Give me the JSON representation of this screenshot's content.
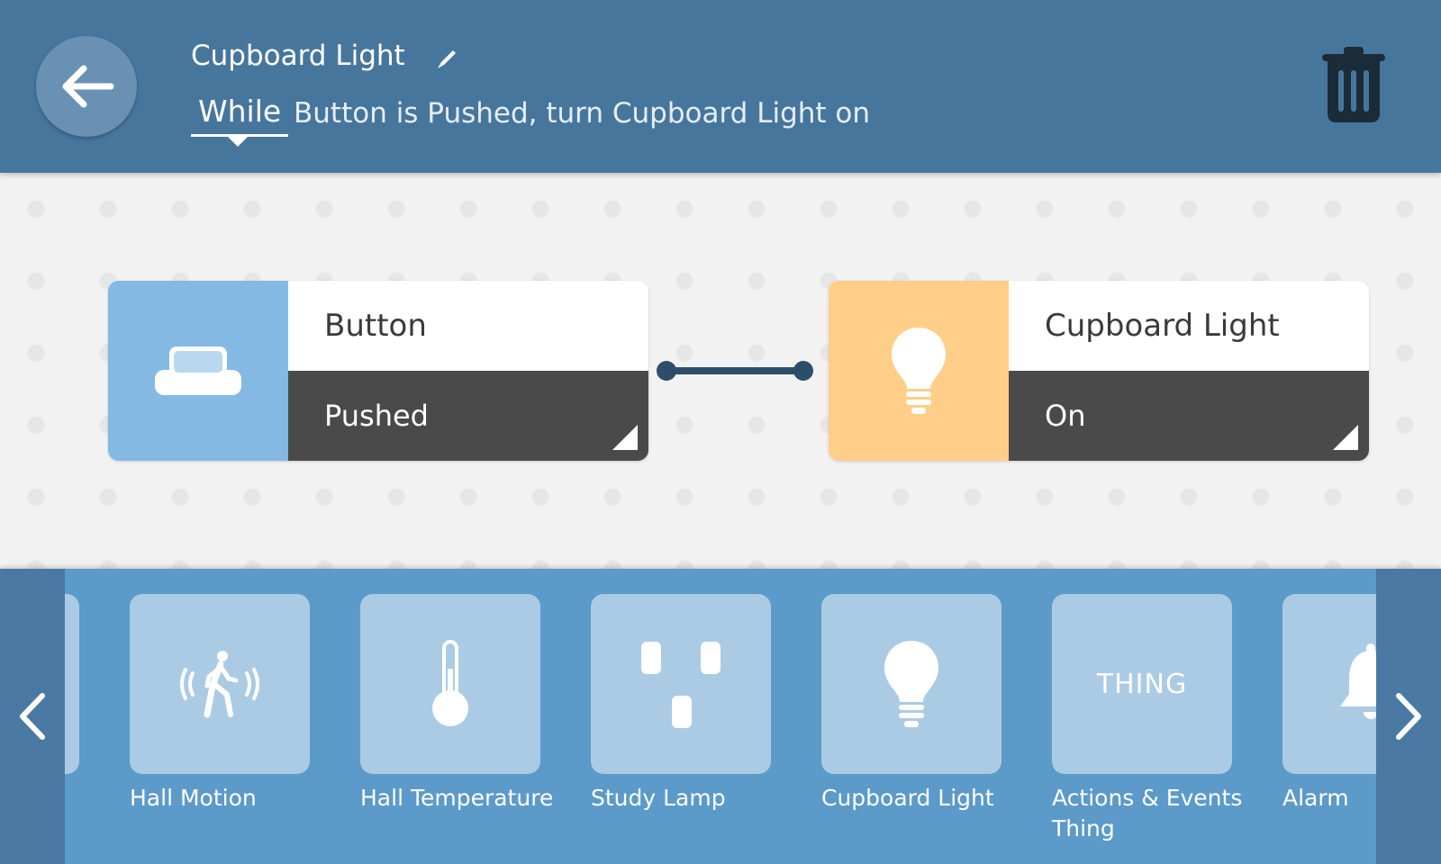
{
  "header": {
    "title": "Cupboard Light",
    "operator": "While",
    "description": "Button is Pushed, turn Cupboard Light on"
  },
  "rule": {
    "trigger": {
      "name": "Button",
      "property": "Pushed",
      "icon": "push-button-icon",
      "color": "#83b9e3"
    },
    "effect": {
      "name": "Cupboard Light",
      "property": "On",
      "icon": "lightbulb-icon",
      "color": "#ffcf89"
    }
  },
  "palette": {
    "items": [
      {
        "label": "Hall Motion",
        "icon": "motion-sensor-icon"
      },
      {
        "label": "Hall Temperature",
        "icon": "thermometer-icon"
      },
      {
        "label": "Study Lamp",
        "icon": "smart-plug-icon"
      },
      {
        "label": "Cupboard Light",
        "icon": "lightbulb-icon"
      },
      {
        "label_line1": "Actions & Events",
        "label_line2": "Thing",
        "tile_text": "THING"
      },
      {
        "label": "Alarm",
        "icon": "bell-icon"
      }
    ]
  },
  "colors": {
    "header": "#47769d",
    "palette": "#5b9ac9",
    "tile": "#abcbe4",
    "property_bar": "#4a4a4a"
  }
}
